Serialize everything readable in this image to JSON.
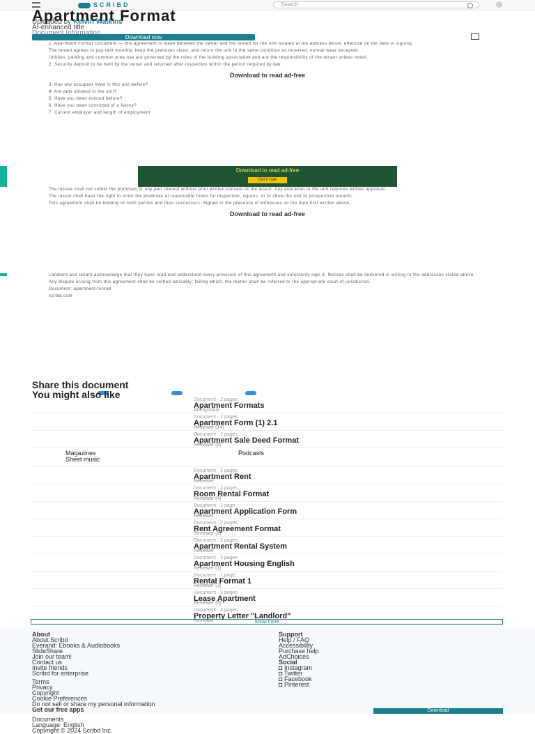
{
  "header": {
    "logo": "SCRIBD",
    "search_placeholder": "Search"
  },
  "document": {
    "title": "Apartment Format",
    "uploaded_by_prefix": "Uploaded by",
    "author": "Kelvin Watkins",
    "ai": "AI-enhanced title",
    "info": "Document Information",
    "download_label": "Download now",
    "paragraphs": [
      "1. Apartment Format Document — this agreement is made between the owner and the tenant for the unit located at the address below, effective on the date of signing.",
      "The tenant agrees to pay rent monthly, keep the premises clean, and return the unit in the same condition as received, normal wear excepted.",
      "Utilities, parking and common area use are governed by the rules of the building association and are the responsibility of the tenant unless noted.",
      "2. Security deposit to be held by the owner and returned after inspection within the period required by law."
    ],
    "download_read": "Download to read ad-free",
    "list_items": [
      "3. Has any occupant lived in this unit before?",
      "4. Are pets allowed in the unit?",
      "5. Have you been evicted before?",
      "6. Have you been convicted of a felony?",
      "7. Current employer and length of employment"
    ],
    "ad_text": "Download to read ad-free",
    "ad_button": "Get it now",
    "body_paragraphs": [
      "The lessee shall not sublet the premises or any part thereof without prior written consent of the lessor. Any alteration to the unit requires written approval.",
      "The lessor shall have the right to enter the premises at reasonable hours for inspection, repairs, or to show the unit to prospective tenants.",
      "This agreement shall be binding on both parties and their successors. Signed in the presence of witnesses on the date first written above."
    ],
    "dense_paragraphs": [
      "Landlord and tenant acknowledge that they have read and understood every provision of this agreement and voluntarily sign it. Notices shall be delivered in writing to the addresses stated above.",
      "Any dispute arising from this agreement shall be settled amicably; failing which, the matter shall be referred to the appropriate court of jurisdiction."
    ],
    "footer_note_1": "Document: apartment-format",
    "footer_note_2": "scribd.com"
  },
  "share": {
    "title": "Share this document"
  },
  "related": {
    "title": "You might also like",
    "sidebar": [
      "Magazines",
      "Sheet music"
    ],
    "podcasts": "Podcasts",
    "items": [
      {
        "meta": "Document · 2 pages",
        "title": "Apartment Formats",
        "sub": "Anonymous"
      },
      {
        "meta": "Document · 2 pages",
        "title": "Apartment Form (1) 2.1",
        "sub": "Reviewer (14)"
      },
      {
        "meta": "Document · 2 pages",
        "title": "Apartment Sale Deed Format",
        "sub": "Reviewer (9)"
      },
      {
        "meta": "Document · 2 pages",
        "title": "Apartment Rent",
        "sub": "Reviewer"
      },
      {
        "meta": "Document · 2 pages",
        "title": "Room Rental Format",
        "sub": "Reviewer (4)"
      },
      {
        "meta": "Document · 1 page",
        "title": "Apartment Application Form",
        "sub": "Reviewer"
      },
      {
        "meta": "Document · 2 pages",
        "title": "Rent Agreement Format",
        "sub": "Reviewer (2)"
      },
      {
        "meta": "Document · 2 pages",
        "title": "Apartment Rental System",
        "sub": "Reviewer"
      },
      {
        "meta": "Document · 3 pages",
        "title": "Apartment Housing English",
        "sub": "Reviewer (1)"
      },
      {
        "meta": "Document · 1 page",
        "title": "Rental Format 1",
        "sub": "Reviewer (3)"
      },
      {
        "meta": "Document · 2 pages",
        "title": "Lease Apartment",
        "sub": "Reviewer (5)"
      },
      {
        "meta": "Document · 3 pages",
        "title": "Property Letter \"Landlord\"",
        "sub": "Reviewer"
      }
    ],
    "show_more": "Show more"
  },
  "footer": {
    "col1_head": "About",
    "col1": [
      "About Scribd",
      "Everand: Ebooks & Audiobooks",
      "SlideShare",
      "Join our team!",
      "Contact us",
      "Invite friends",
      "Scribd for enterprise"
    ],
    "col1b": [
      "Terms",
      "Privacy",
      "Copyright",
      "Cookie Preferences",
      "Do not sell or share my personal information"
    ],
    "col1c": "Get our free apps",
    "col2_head": "Support",
    "col2": [
      "Help / FAQ",
      "Accessibility",
      "Purchase help",
      "AdChoices"
    ],
    "col3_head": "Social",
    "col3": [
      "Instagram",
      "Twitter",
      "Facebook",
      "Pinterest"
    ],
    "bottom": [
      "Documents",
      "Language: English",
      "Copyright © 2024 Scribd Inc."
    ],
    "download": "Download"
  }
}
